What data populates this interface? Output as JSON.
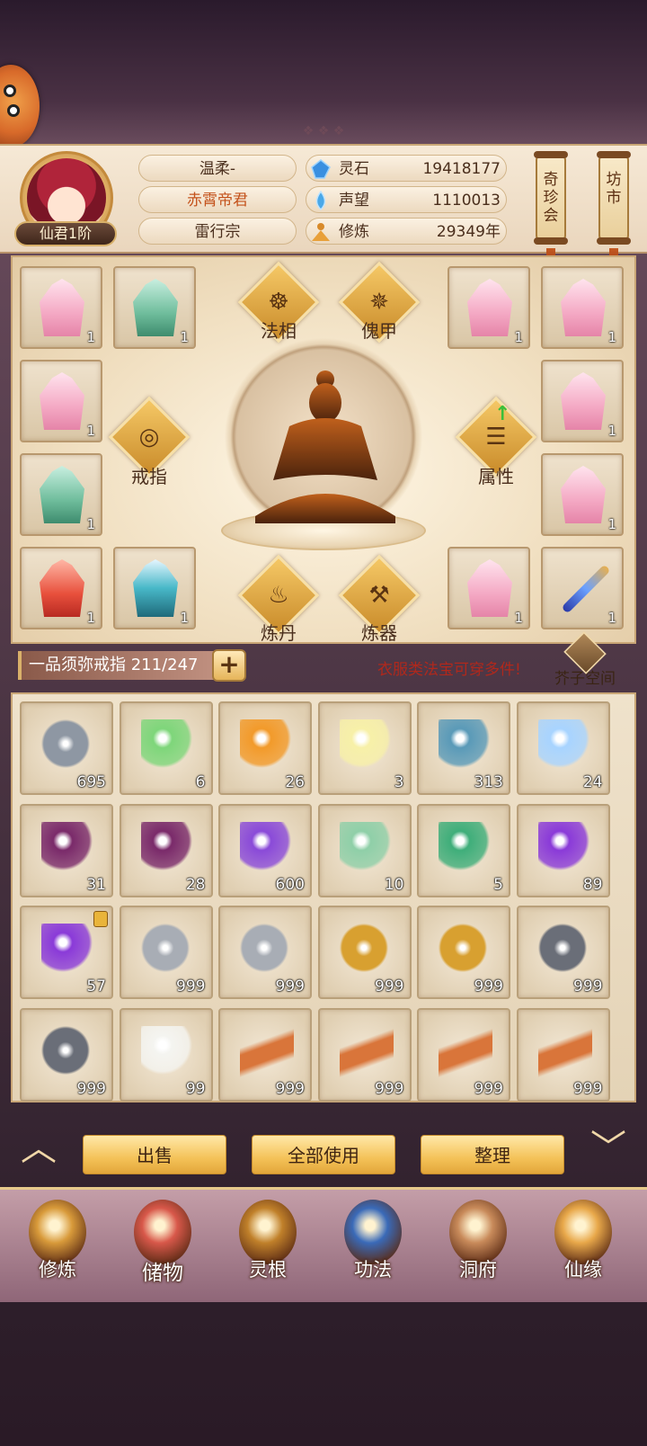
{
  "player": {
    "name": "温柔-",
    "title": "赤霄帝君",
    "sect": "雷行宗",
    "rank": "仙君1阶"
  },
  "stats": [
    {
      "label": "灵石",
      "value": "19418177",
      "icon": "spirit-stone-icon"
    },
    {
      "label": "声望",
      "value": "1110013",
      "icon": "reputation-icon"
    },
    {
      "label": "修炼",
      "value": "29349年",
      "icon": "cultivation-icon"
    }
  ],
  "top_buttons": {
    "treasure_auction": "奇珍会",
    "market": "坊市"
  },
  "equipment": {
    "slots_left": [
      {
        "item": "pink-robe",
        "count": "1"
      },
      {
        "item": "green-robe",
        "count": "1"
      },
      {
        "item": "pink-robe",
        "count": "1"
      },
      {
        "item": "green-robe",
        "count": "1"
      },
      {
        "item": "red-robe",
        "count": "1"
      },
      {
        "item": "teal-robe",
        "count": "1"
      }
    ],
    "slots_right": [
      {
        "item": "pink-robe",
        "count": "1"
      },
      {
        "item": "pink-robe",
        "count": "1"
      },
      {
        "item": "pink-robe",
        "count": "1"
      },
      {
        "item": "pink-robe",
        "count": "1"
      },
      {
        "item": "pink-robe",
        "count": "1"
      },
      {
        "item": "sword",
        "count": "1"
      }
    ],
    "functions": {
      "faxiang": "法相",
      "kuijia": "傀甲",
      "jiezhi": "戒指",
      "shuxing": "属性",
      "liandan": "炼丹",
      "lianqi": "炼器"
    }
  },
  "ring_bar": {
    "label": "一品须弥戒指 211/247",
    "plus": "+",
    "hint": "衣服类法宝可穿多件!",
    "bag_space": "芥子空间"
  },
  "inventory": [
    {
      "item": "iron-ore",
      "count": "695",
      "color": "#8e97a3"
    },
    {
      "item": "jade-chest",
      "count": "6",
      "color": "#7ed67a"
    },
    {
      "item": "fire-crystal",
      "count": "26",
      "color": "#f29a2a"
    },
    {
      "item": "light-crystal",
      "count": "3",
      "color": "#f7f0a8"
    },
    {
      "item": "water-orb",
      "count": "313",
      "color": "#5a9ab8"
    },
    {
      "item": "spirit-orb",
      "count": "24",
      "color": "#a8d4ff"
    },
    {
      "item": "dark-flame",
      "count": "31",
      "color": "#7a2a6a"
    },
    {
      "item": "dark-flame",
      "count": "28",
      "color": "#7a2a6a"
    },
    {
      "item": "spirit-flower",
      "count": "600",
      "color": "#8a4ad8"
    },
    {
      "item": "jade-talisman",
      "count": "10",
      "color": "#8fcfa8"
    },
    {
      "item": "jade-talisman",
      "count": "5",
      "color": "#3fae7a"
    },
    {
      "item": "purple-orb",
      "count": "89",
      "color": "#8a3ad8"
    },
    {
      "item": "purple-orb",
      "count": "57",
      "color": "#8a3ad8",
      "locked": true
    },
    {
      "item": "silver-ore",
      "count": "999",
      "color": "#a8adb5"
    },
    {
      "item": "silver-ore",
      "count": "999",
      "color": "#a8adb5"
    },
    {
      "item": "gold-ore",
      "count": "999",
      "color": "#d8a030"
    },
    {
      "item": "gold-ore",
      "count": "999",
      "color": "#d8a030"
    },
    {
      "item": "black-ore",
      "count": "999",
      "color": "#6a6e78"
    },
    {
      "item": "black-ore",
      "count": "999",
      "color": "#6a6e78"
    },
    {
      "item": "white-lily",
      "count": "99",
      "color": "#f4f4f0"
    },
    {
      "item": "ginseng",
      "count": "999",
      "color": "#d9753a"
    },
    {
      "item": "ginseng",
      "count": "999",
      "color": "#d9753a"
    },
    {
      "item": "ginseng",
      "count": "999",
      "color": "#d9753a"
    },
    {
      "item": "ginseng",
      "count": "999",
      "color": "#d9753a"
    }
  ],
  "actions": {
    "sell": "出售",
    "use_all": "全部使用",
    "sort": "整理"
  },
  "nav": [
    {
      "label": "修炼",
      "icon": "cultivation-nav-icon"
    },
    {
      "label": "储物",
      "icon": "storage-bag-icon",
      "active": true
    },
    {
      "label": "灵根",
      "icon": "spirit-root-icon"
    },
    {
      "label": "功法",
      "icon": "technique-book-icon"
    },
    {
      "label": "洞府",
      "icon": "cave-dwelling-icon"
    },
    {
      "label": "仙缘",
      "icon": "fairy-fate-icon"
    }
  ]
}
